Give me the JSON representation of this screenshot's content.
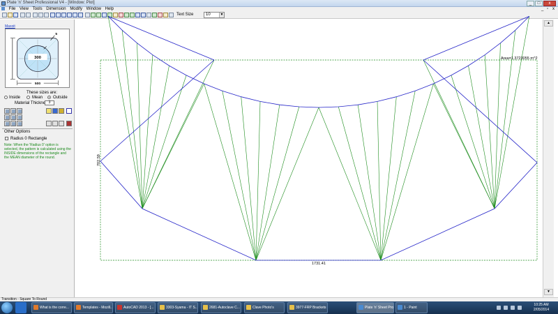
{
  "window": {
    "title": "Plate 'n' Sheet Professional V4 - [Window: Plot]",
    "minimize": "_",
    "maximize": "□",
    "close": "x"
  },
  "menu": {
    "items": [
      "File",
      "View",
      "Tools",
      "Dimension",
      "Modify",
      "Window",
      "Help"
    ]
  },
  "toolbar": {
    "text_size_label": "Text Size",
    "text_size_value": "10"
  },
  "panel": {
    "form_link": "Maxoit",
    "preview": {
      "diameter": "300",
      "width": "500",
      "corner_radius": "5"
    },
    "sizes_caption": "These sizes are:",
    "size_options": [
      {
        "label": "Inside",
        "selected": false
      },
      {
        "label": "Mean",
        "selected": false
      },
      {
        "label": "Outside",
        "selected": true
      }
    ],
    "thickness_label": "Material Thickness:",
    "thickness_value": "3",
    "other_options_label": "Other Options",
    "radius_checkbox_label": "Radius 0 Rectangle",
    "note": "Note: When the 'Radius 0' option is selected, the pattern is calculated using the INSIDE dimensions of the rectangle and the MEAN diameter of the round."
  },
  "drawing": {
    "area_label": "Area=1.3723055 m^2",
    "width_dim": "1731.41",
    "height_dim": "702.59",
    "colors": {
      "outline": "#2323c8",
      "fold_lines": "#1c8c1c",
      "bounding_box": "#1c8c1c"
    }
  },
  "statusbar": {
    "text": "Transition - Square To Round"
  },
  "taskbar": {
    "apps": [
      {
        "label": "What is the corre...",
        "color": "#e07a2c"
      },
      {
        "label": "Templates - Mozill...",
        "color": "#e07a2c"
      },
      {
        "label": "AutoCAD 2013 - [...",
        "color": "#c8332e"
      },
      {
        "label": "3303-Syama - IT S...",
        "color": "#e6c04a"
      },
      {
        "label": "2681-Autoclave C...",
        "color": "#e6c04a"
      },
      {
        "label": "Clave Photo's",
        "color": "#e6c04a"
      },
      {
        "label": "3977-FRP Brackets",
        "color": "#e6c04a"
      },
      {
        "label": "Plate 'n' Sheet Pro...",
        "color": "#4a8ad0",
        "active": true
      },
      {
        "label": "1 - Paint",
        "color": "#4a8ad0"
      }
    ],
    "time": "10:25 AM",
    "date": "2/05/2014"
  }
}
